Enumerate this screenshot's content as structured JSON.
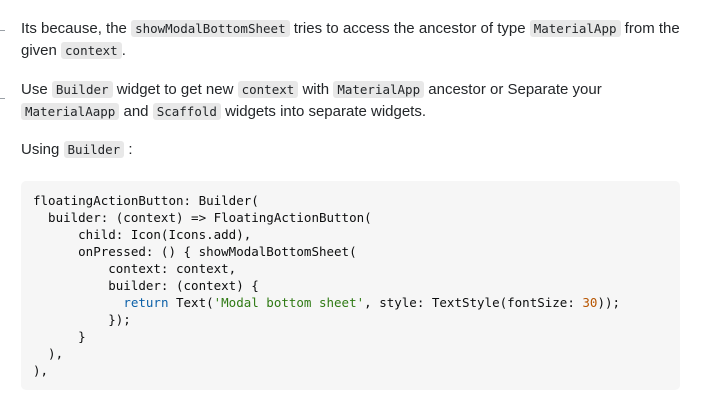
{
  "answer": {
    "p1": {
      "t1": "Its because, the ",
      "c1": "showModalBottomSheet",
      "t2": " tries to access the ancestor of type ",
      "c2": "MaterialApp",
      "t3": " from the given ",
      "c3": "context",
      "t4": "."
    },
    "p2": {
      "t1": "Use ",
      "c1": "Builder",
      "t2": " widget to get new ",
      "c2": "context",
      "t3": " with ",
      "c3": "MaterialApp",
      "t4": " ancestor or Separate your ",
      "c4": "MaterialAapp",
      "t5": " and ",
      "c5": "Scaffold",
      "t6": " widgets into separate widgets."
    },
    "p3": {
      "t1": "Using ",
      "c1": "Builder",
      "t2": " :"
    },
    "code": {
      "l1": "floatingActionButton: Builder(",
      "l2": "  builder: (context) => FloatingActionButton(",
      "l3": "      child: Icon(Icons.add),",
      "l4": "      onPressed: () { showModalBottomSheet(",
      "l5": "          context: context,",
      "l6": "          builder: (context) {",
      "l7_indent": "            ",
      "l7_kw": "return",
      "l7_a": " Text(",
      "l7_str": "'Modal bottom sheet'",
      "l7_b": ", style: TextStyle(fontSize: ",
      "l7_num": "30",
      "l7_c": "));",
      "l8": "          });",
      "l9": "      }",
      "l10": "  ),",
      "l11": "),"
    }
  }
}
